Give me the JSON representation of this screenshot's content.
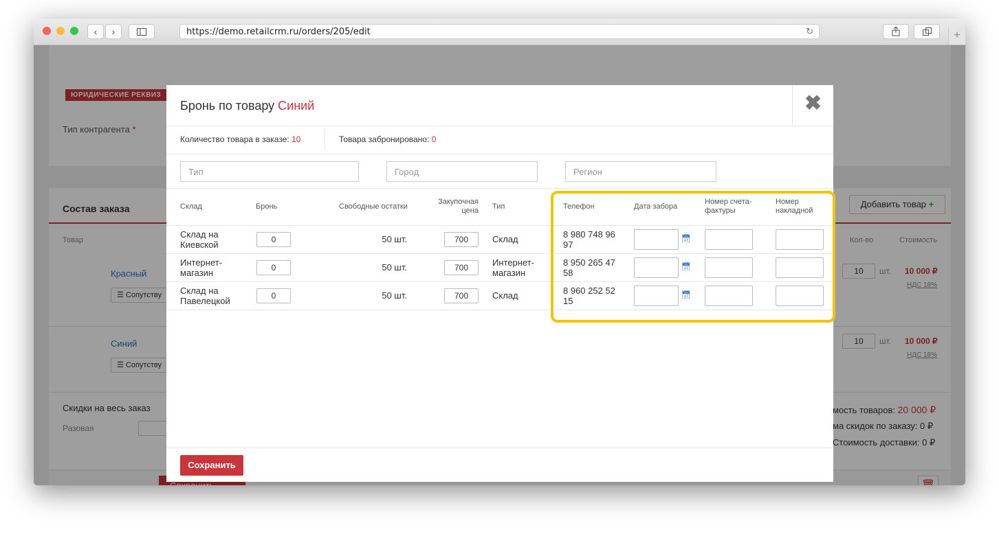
{
  "browser": {
    "url": "https://demo.retailcrm.ru/orders/205/edit",
    "back_icon": "chevron-left-icon",
    "forward_icon": "chevron-right-icon",
    "sidebar_icon": "sidebar-icon",
    "share_icon": "share-icon",
    "tabs_icon": "tabs-icon",
    "reload_icon": "reload-icon",
    "newtab_label": "+"
  },
  "background": {
    "legal_tag": "ЮРИДИЧЕСКИЕ РЕКВИЗ",
    "counterparty_label": "Тип контрагента",
    "required_mark": "*",
    "order_title": "Состав заказа",
    "add_product": "Добавить товар",
    "add_plus": "+",
    "col_product": "Товар",
    "col_qty": "Кол-во",
    "col_cost": "Стоимость",
    "rows": [
      {
        "name": "Красный",
        "companion": "☰ Сопутству",
        "qty": "10",
        "unit": "шт.",
        "cost": "10 000 ₽",
        "vat": "НДС 18%"
      },
      {
        "name": "Синий",
        "companion": "☰ Сопутству",
        "qty": "10",
        "unit": "шт.",
        "cost": "10 000 ₽",
        "vat": "НДС 18%"
      }
    ],
    "discount_title": "Скидки на весь заказ",
    "discount_once": "Разовая",
    "total_goods_label": "мость товаров:",
    "total_goods_value": "20 000 ₽",
    "total_discount_label": "ма скидок по заказу:",
    "total_discount_value": "0 ₽",
    "delivery_label": "Стоимость доставки:",
    "delivery_value": "0 ₽",
    "save_label": "Сохранить",
    "colors": {
      "accent": "#c9353b",
      "link": "#2a6fc4"
    }
  },
  "modal": {
    "title_prefix": "Бронь по товару",
    "title_product": "Синий",
    "qty_in_order_label": "Количество товара в заказе:",
    "qty_in_order_value": "10",
    "reserved_label": "Товара забронировано:",
    "reserved_value": "0",
    "filters": {
      "type": "Тип",
      "city": "Город",
      "region": "Регион"
    },
    "headers": {
      "warehouse": "Склад",
      "reserve": "Бронь",
      "free_stock": "Свободные остатки",
      "purchase_price": [
        "Закупочная",
        "цена"
      ],
      "type": "Тип",
      "phone": "Телефон",
      "pickup_date": "Дата забора",
      "invoice_no": [
        "Номер счета-",
        "фактуры"
      ],
      "waybill_no": [
        "Номер",
        "накладной"
      ]
    },
    "rows": [
      {
        "warehouse": [
          "Склад на",
          "Киевской"
        ],
        "reserve": "0",
        "stock": "50 шт.",
        "price": "700",
        "type": [
          "Склад"
        ],
        "phone": [
          "8 980 748 96",
          "97"
        ]
      },
      {
        "warehouse": [
          "Интернет-",
          "магазин"
        ],
        "reserve": "0",
        "stock": "50 шт.",
        "price": "700",
        "type": [
          "Интернет-",
          "магазин"
        ],
        "phone": [
          "8 950 265 47",
          "58"
        ]
      },
      {
        "warehouse": [
          "Склад на",
          "Павелецкой"
        ],
        "reserve": "0",
        "stock": "50 шт.",
        "price": "700",
        "type": [
          "Склад"
        ],
        "phone": [
          "8 960 252 52",
          "15"
        ]
      }
    ],
    "calendar_icon": "calendar-icon",
    "close_icon": "close-icon",
    "close_glyph": "✖",
    "save_label": "Сохранить",
    "highlight_color": "#f5c400"
  }
}
